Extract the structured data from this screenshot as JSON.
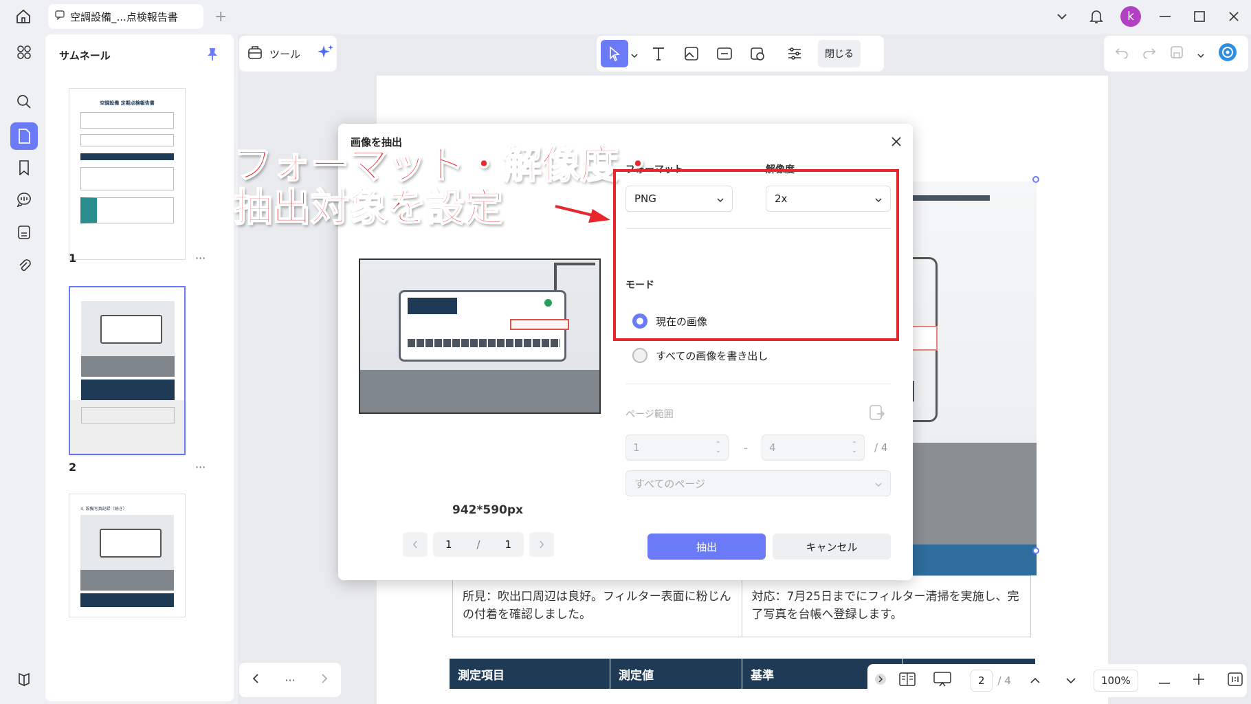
{
  "titlebar": {
    "tab_title": "空調設備_...点検報告書"
  },
  "avatar": {
    "initial": "k"
  },
  "thumbnails": {
    "title": "サムネール",
    "pages": [
      {
        "number": "1",
        "more": "···"
      },
      {
        "number": "2",
        "more": "···"
      }
    ],
    "thumb1_heading": "空調設備 定期点検報告書",
    "thumb3_heading": "4. 設備写真記録（続き）"
  },
  "toolbar": {
    "tools_label": "ツール",
    "close_label": "閉じる"
  },
  "document": {
    "finding_text": "所見：吹出口周辺は良好。フィルター表面に粉じんの付着を確認しました。",
    "action_text": "対応：7月25日までにフィルター清掃を実施し、完了写真を台帳へ登録します。",
    "table_headers": [
      "測定項目",
      "測定値",
      "基準"
    ]
  },
  "zoombar": {
    "page_current": "2",
    "page_total": "/ 4",
    "zoom": "100%"
  },
  "nav_bottom": {
    "more": "···"
  },
  "dialog": {
    "title": "画像を抽出",
    "format_label": "フォーマット",
    "format_value": "PNG",
    "resolution_label": "解像度",
    "resolution_value": "2x",
    "mode_label": "モード",
    "mode_options": [
      "現在の画像",
      "すべての画像を書き出し"
    ],
    "mode_selected": "現在の画像",
    "page_range_label": "ページ範囲",
    "range_from": "1",
    "range_to": "4",
    "range_total": "/ 4",
    "range_separator": "-",
    "range_select": "すべてのページ",
    "image_size": "942*590px",
    "pager_current": "1",
    "pager_sep": "/",
    "pager_total": "1",
    "extract_label": "抽出",
    "cancel_label": "キャンセル"
  },
  "annotation": {
    "line1": "フォーマット・解像度・",
    "line2": "抽出対象を設定"
  },
  "colors": {
    "accent": "#6b7bf7",
    "annotation_red": "#e8262d",
    "table_header": "#1f3a55"
  }
}
